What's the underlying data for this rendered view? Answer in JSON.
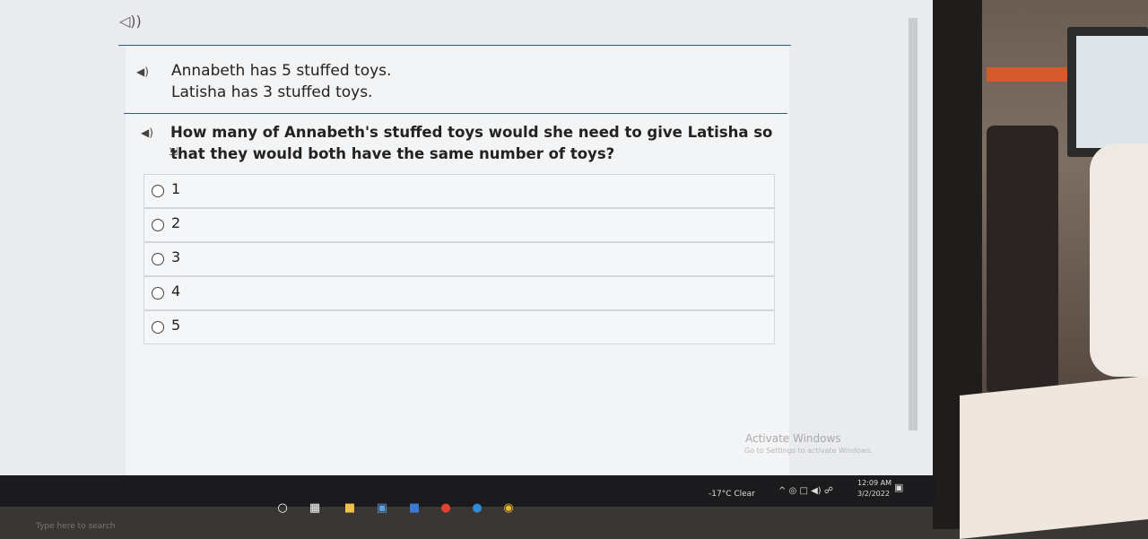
{
  "stem": {
    "line1": "Annabeth has 5 stuffed toys.",
    "line2": "Latisha has 3 stuffed toys."
  },
  "question": {
    "text": "How many of Annabeth's stuffed toys would she need to give Latisha so that they would both have the same number of toys?"
  },
  "options": [
    "1",
    "2",
    "3",
    "4",
    "5"
  ],
  "watermark": {
    "title": "Activate Windows",
    "subtitle": "Go to Settings to activate Windows."
  },
  "taskbar": {
    "search_placeholder": "Type here to search",
    "weather": "-17°C Clear",
    "time": "12:09 AM",
    "date": "3/2/2022"
  },
  "icons": {
    "speaker": "speaker-icon",
    "radio": "radio-button"
  },
  "colors": {
    "rule": "#2d5e7a",
    "taskbar": "#1b1b1d"
  }
}
